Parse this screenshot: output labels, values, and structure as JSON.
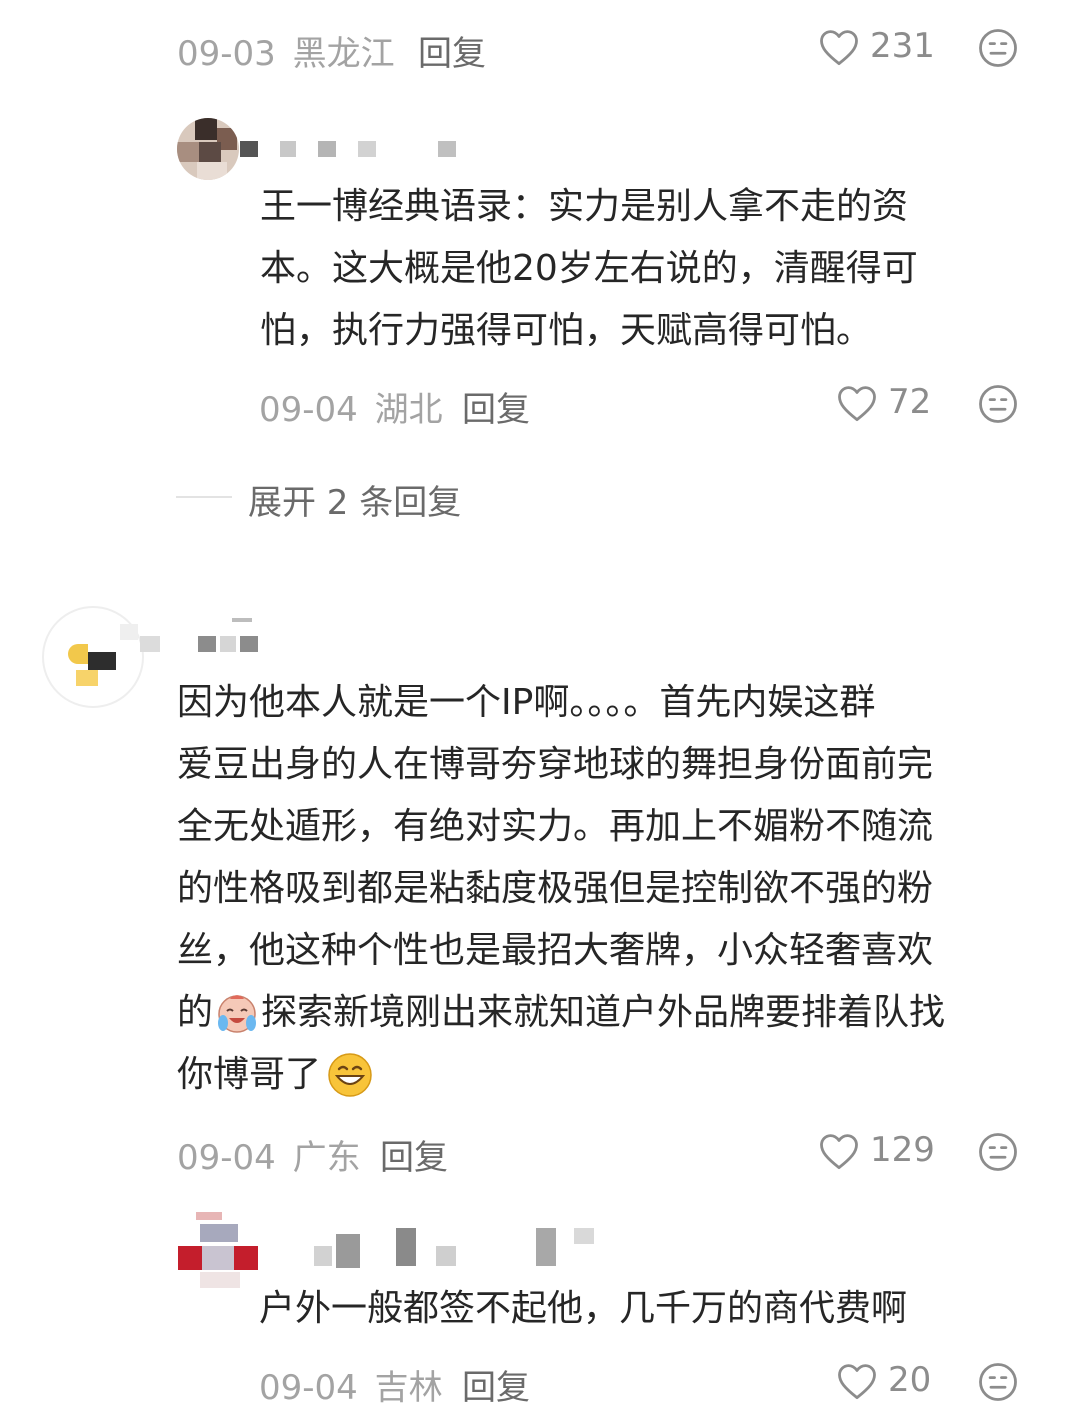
{
  "comments": [
    {
      "date": "09-03",
      "location": "黑龙江",
      "reply_label": "回复",
      "likes": "231"
    },
    {
      "date": "09-04",
      "location": "湖北",
      "reply_label": "回复",
      "likes": "72",
      "text_lines": [
        "王一博经典语录：实力是别人拿不走的资",
        "本。这大概是他20岁左右说的，清醒得可",
        "怕，执行力强得可怕，天赋高得可怕。"
      ]
    },
    {
      "expand_label": "展开 2 条回复"
    },
    {
      "date": "09-04",
      "location": "广东",
      "reply_label": "回复",
      "likes": "129",
      "text_lines": [
        "因为他本人就是一个IP啊。。。。首先内娱这群",
        "爱豆出身的人在博哥夯穿地球的舞担身份面前完",
        "全无处遁形，有绝对实力。再加上不媚粉不随流",
        "的性格吸到都是粘黏度极强但是控制欲不强的粉",
        "丝，他这种个性也是最招大奢牌，小众轻奢喜欢",
        "探索新境刚出来就知道户外品牌要排着队找",
        "你博哥了"
      ],
      "line6_prefix": "的"
    },
    {
      "date": "09-04",
      "location": "吉林",
      "reply_label": "回复",
      "likes": "20",
      "text_lines": [
        "户外一般都签不起他，几千万的商代费啊"
      ]
    }
  ],
  "icons": {
    "like": "heart-outline-icon",
    "dislike": "meh-face-icon",
    "emoji_crying": "crying-laughing-emoji",
    "emoji_smile": "grinning-emoji"
  },
  "colors": {
    "meta": "#a3a3a3",
    "text": "#262626",
    "icon": "#8c8c8c"
  }
}
